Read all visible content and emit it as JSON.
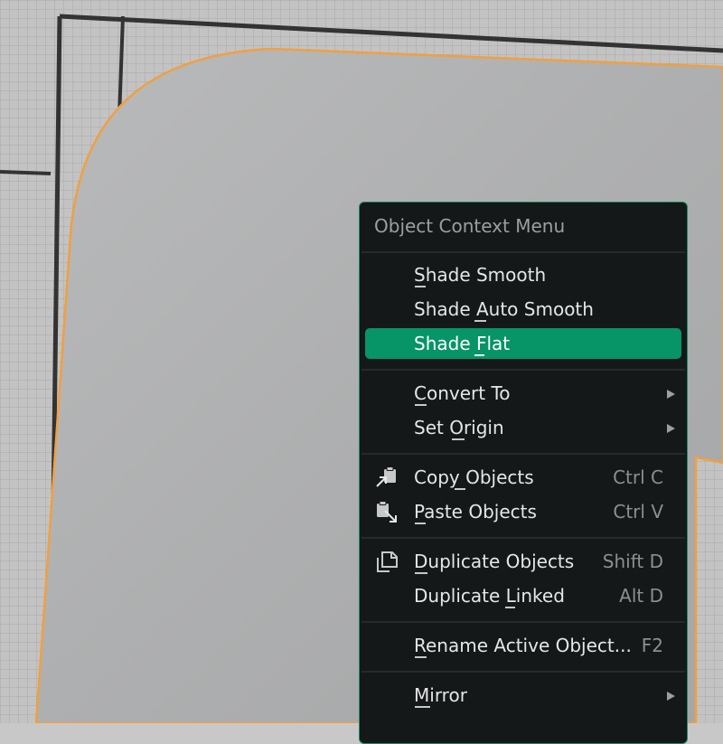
{
  "menu": {
    "title": "Object Context Menu",
    "items": [
      {
        "label": "Shade Smooth"
      },
      {
        "label": "Shade Auto Smooth"
      },
      {
        "label": "Shade Flat"
      },
      {
        "label": "Convert To"
      },
      {
        "label": "Set Origin"
      },
      {
        "label": "Copy Objects",
        "shortcut": "Ctrl C",
        "icon": "copy-objects-icon"
      },
      {
        "label": "Paste Objects",
        "shortcut": "Ctrl V",
        "icon": "paste-objects-icon"
      },
      {
        "label": "Duplicate Objects",
        "shortcut": "Shift D",
        "icon": "duplicate-icon"
      },
      {
        "label": "Duplicate Linked",
        "shortcut": "Alt D"
      },
      {
        "label": "Rename Active Object...",
        "shortcut": "F2"
      },
      {
        "label": "Mirror"
      }
    ]
  },
  "colors": {
    "accent": "#079467",
    "menu_background": "#141818",
    "selection_outline": "#f0a040"
  }
}
